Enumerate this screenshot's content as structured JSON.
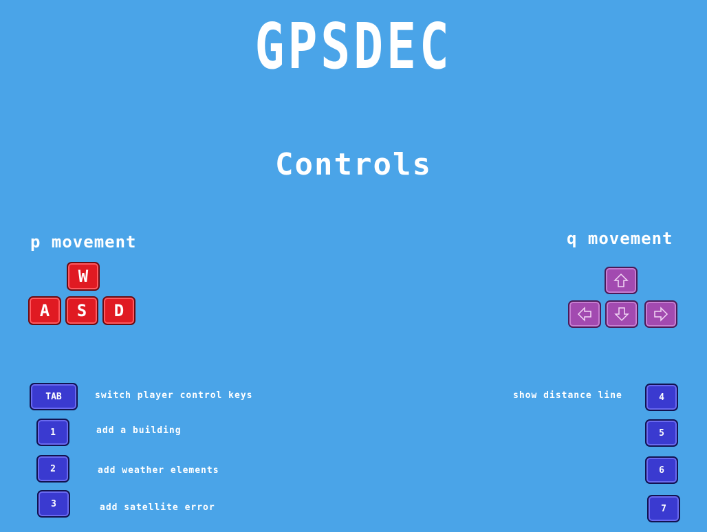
{
  "title": "GPSDEC",
  "subtitle": "Controls",
  "p_movement": {
    "label": "p movement",
    "keys": {
      "up": "W",
      "left": "A",
      "down": "S",
      "right": "D"
    }
  },
  "q_movement": {
    "label": "q movement",
    "keys": [
      "arrow-up-icon",
      "arrow-left-icon",
      "arrow-down-icon",
      "arrow-right-icon"
    ]
  },
  "left_controls": [
    {
      "key": "TAB",
      "text": "switch player control keys"
    },
    {
      "key": "1",
      "text": "add a building"
    },
    {
      "key": "2",
      "text": "add weather elements"
    },
    {
      "key": "3",
      "text": "add satellite error"
    }
  ],
  "right_controls": [
    {
      "key": "4",
      "text": "show distance line"
    },
    {
      "key": "5",
      "text": ""
    },
    {
      "key": "6",
      "text": ""
    },
    {
      "key": "7",
      "text": ""
    }
  ],
  "colors": {
    "background": "#4aa4e8",
    "p_keys": "#e01a22",
    "q_keys": "#a24ab0",
    "action_keys": "#3a3ad0"
  }
}
